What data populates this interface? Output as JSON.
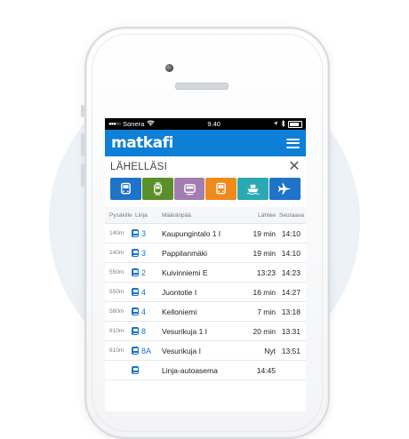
{
  "status": {
    "carrier": "Sonera",
    "time": "9.40"
  },
  "app": {
    "logo": "matkafi"
  },
  "nearby": {
    "title": "LÄHELLÄSI"
  },
  "modes": [
    {
      "name": "bus",
      "color": "#1f73c8",
      "icon": "bus-icon"
    },
    {
      "name": "tram",
      "color": "#5a8f2a",
      "icon": "tram-icon"
    },
    {
      "name": "metro",
      "color": "#a27db2",
      "icon": "metro-icon"
    },
    {
      "name": "regional-bus",
      "color": "#f08a1c",
      "icon": "bus-icon"
    },
    {
      "name": "ferry",
      "color": "#2aa9b5",
      "icon": "ferry-icon"
    },
    {
      "name": "flight",
      "color": "#1f73c8",
      "icon": "plane-icon"
    }
  ],
  "table": {
    "headers": {
      "stop": "Pysäkille",
      "line": "Linja",
      "destination": "Määränpää",
      "departs": "Lähtee",
      "next": "Seuraava"
    },
    "rows": [
      {
        "dist": "140m",
        "line": "3",
        "dest": "Kaupungintalo 1 I",
        "dep": "19 min",
        "next": "14:10"
      },
      {
        "dist": "140m",
        "line": "3",
        "dest": "Pappilanmäki",
        "dep": "19 min",
        "next": "14:10"
      },
      {
        "dist": "550m",
        "line": "2",
        "dest": "Kuivinniemi E",
        "dep": "13:23",
        "next": "14:23"
      },
      {
        "dist": "550m",
        "line": "4",
        "dest": "Juontotie I",
        "dep": "16 min",
        "next": "14:27"
      },
      {
        "dist": "580m",
        "line": "4",
        "dest": "Kelloniemi",
        "dep": "7 min",
        "next": "13:18"
      },
      {
        "dist": "610m",
        "line": "8",
        "dest": "Vesurikuja 1 I",
        "dep": "20 min",
        "next": "13:31"
      },
      {
        "dist": "610m",
        "line": "8A",
        "dest": "Vesurikuja I",
        "dep": "Nyt",
        "next": "13:51"
      },
      {
        "dist": "",
        "line": "",
        "dest": "Linja-autoasema",
        "dep": "14:45",
        "next": ""
      }
    ]
  }
}
